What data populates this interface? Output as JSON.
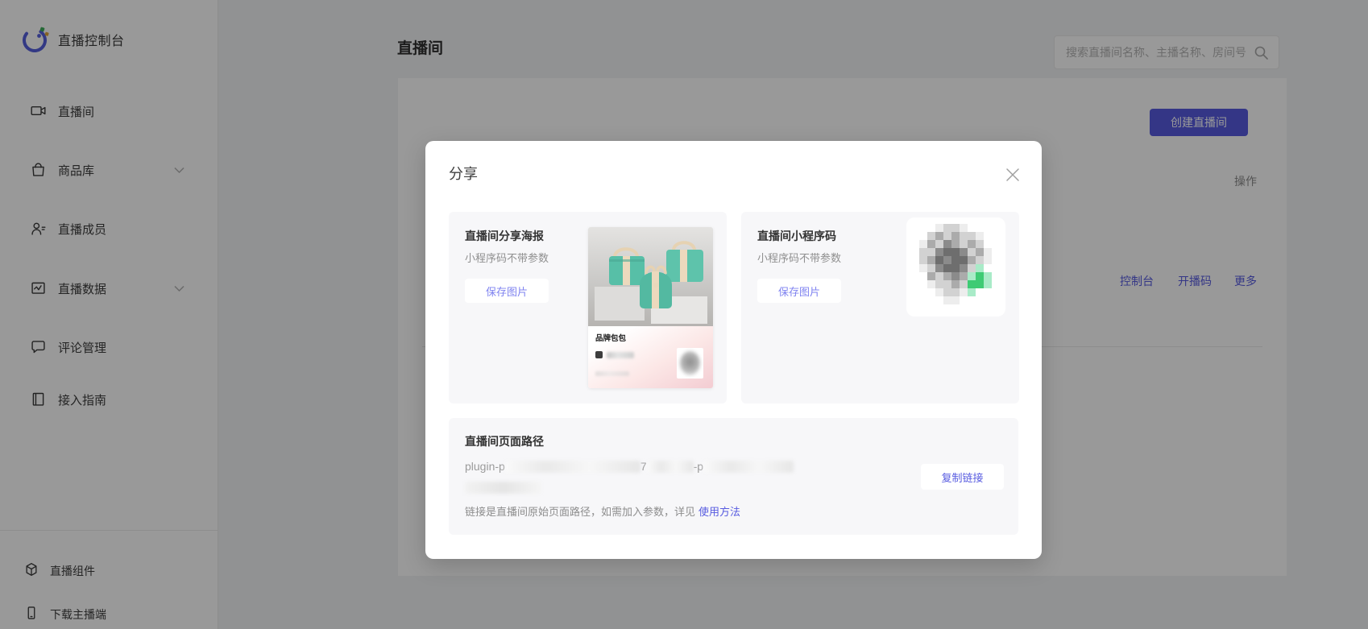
{
  "brand": {
    "title": "直播控制台"
  },
  "sidebar": {
    "items": [
      {
        "label": "直播间",
        "expandable": false
      },
      {
        "label": "商品库",
        "expandable": true
      },
      {
        "label": "直播成员",
        "expandable": false
      },
      {
        "label": "直播数据",
        "expandable": true
      },
      {
        "label": "评论管理",
        "expandable": false
      },
      {
        "label": "接入指南",
        "expandable": false
      }
    ],
    "footer_items": [
      {
        "label": "直播组件"
      },
      {
        "label": "下载主播端"
      }
    ]
  },
  "header": {
    "page_title": "直播间",
    "search_placeholder": "搜索直播间名称、主播名称、房间号"
  },
  "content": {
    "create_button": "创建直播间",
    "column_header": "操作",
    "row_actions": [
      "控制台",
      "开播码",
      "更多"
    ]
  },
  "modal": {
    "title": "分享",
    "poster_card": {
      "title": "直播间分享海报",
      "subtitle": "小程序码不带参数",
      "button": "保存图片",
      "poster_label": "品牌包包"
    },
    "qrcode_card": {
      "title": "直播间小程序码",
      "subtitle": "小程序码不带参数",
      "button": "保存图片"
    },
    "path_section": {
      "title": "直播间页面路径",
      "path_fragments": [
        "plugin-p",
        "7",
        "-p"
      ],
      "copy_button": "复制链接",
      "note": "链接是直播间原始页面路径，如需加入参数，详见",
      "note_link": "使用方法"
    }
  },
  "colors": {
    "accent": "#575BE0",
    "accent_light": "#7F83F0",
    "poster_teal": "#57BFA7",
    "qr_green": "#3ECB74"
  }
}
